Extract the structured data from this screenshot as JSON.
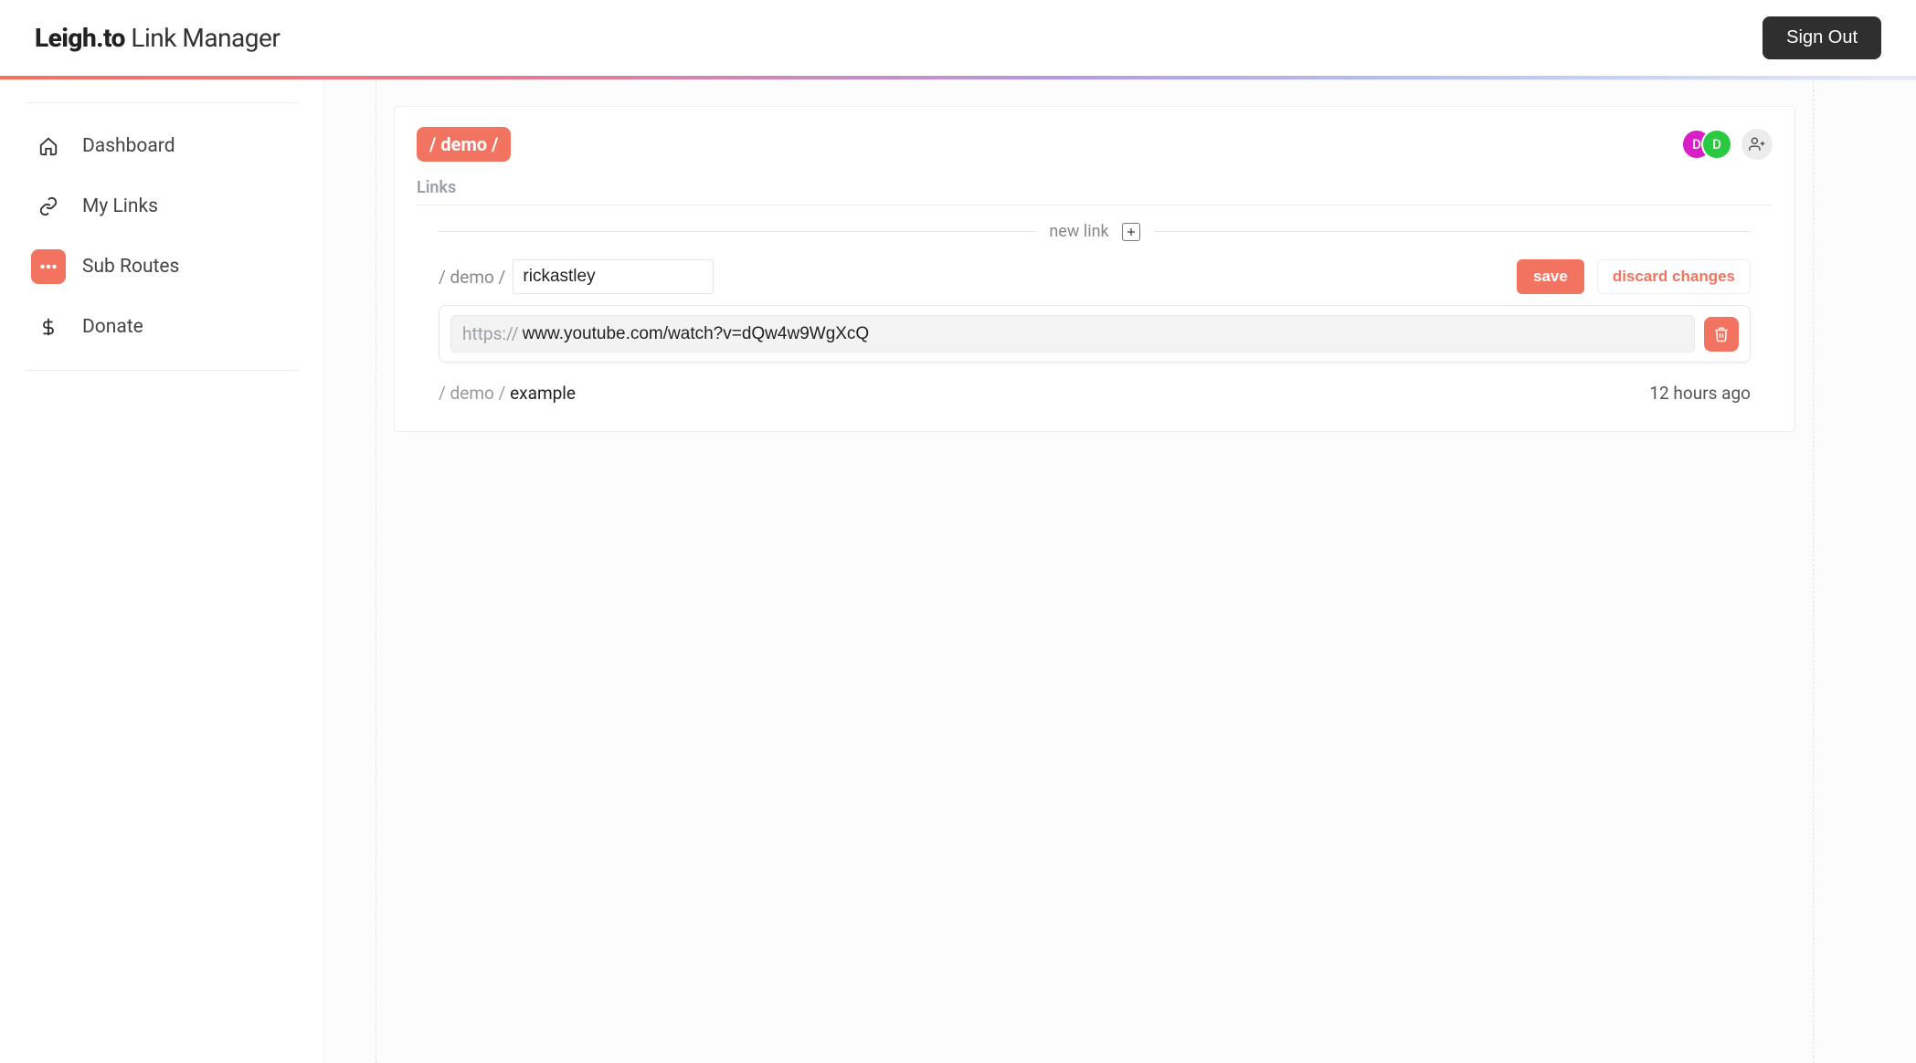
{
  "header": {
    "brand_bold": "Leigh.to",
    "brand_light": " Link Manager",
    "signout": "Sign Out"
  },
  "sidebar": {
    "items": [
      {
        "label": "Dashboard"
      },
      {
        "label": "My Links"
      },
      {
        "label": "Sub Routes"
      },
      {
        "label": "Donate"
      }
    ]
  },
  "route": {
    "chip": "/ demo /",
    "section_label": "Links",
    "collaborators": [
      {
        "initial": "D"
      },
      {
        "initial": "D"
      }
    ],
    "new_link_label": "new link",
    "edit": {
      "prefix": "/ demo /",
      "value": "rickastley",
      "save": "save",
      "discard": "discard changes",
      "url_prefix": "https://",
      "url_value": "www.youtube.com/watch?v=dQw4w9WgXcQ"
    },
    "existing": {
      "prefix": "/ demo / ",
      "name": "example",
      "timestamp": "12 hours ago"
    }
  }
}
